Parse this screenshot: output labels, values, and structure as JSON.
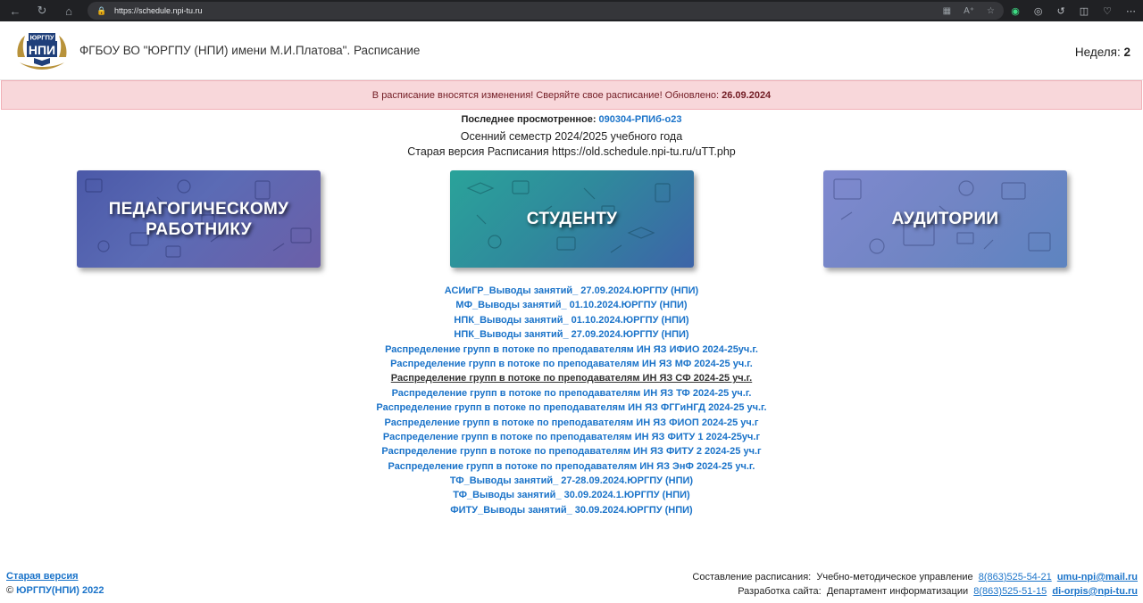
{
  "browser": {
    "url": "https://schedule.npi-tu.ru"
  },
  "header": {
    "logo_text_top": "ЮРГПУ",
    "logo_text_mid": "НПИ",
    "title": "ФГБОУ ВО \"ЮРГПУ (НПИ) имени М.И.Платова\". Расписание",
    "week_label": "Неделя:",
    "week_value": "2"
  },
  "alert": {
    "text": "В расписание вносятся изменения! Сверяйте свое расписание! Обновлено:",
    "date": "26.09.2024"
  },
  "info": {
    "last_viewed_label": "Последнее просмотренное:",
    "last_viewed_link": "090304-РПИб-о23",
    "semester": "Осенний семестр 2024/2025 учебного года",
    "old_version": "Старая версия Расписания https://old.schedule.npi-tu.ru/uTT.php"
  },
  "tiles": {
    "teacher_line1": "ПЕДАГОГИЧЕСКОМУ",
    "teacher_line2": "РАБОТНИКУ",
    "student": "СТУДЕНТУ",
    "room": "АУДИТОРИИ"
  },
  "links": [
    "АСИиГР_Выводы занятий_ 27.09.2024.ЮРГПУ (НПИ)",
    "МФ_Выводы занятий_ 01.10.2024.ЮРГПУ (НПИ)",
    "НПК_Выводы занятий_ 01.10.2024.ЮРГПУ (НПИ)",
    "НПК_Выводы занятий_ 27.09.2024.ЮРГПУ (НПИ)",
    "Распределение групп в потоке по преподавателям ИН ЯЗ ИФИО 2024-25уч.г.",
    "Распределение групп в потоке по преподавателям ИН ЯЗ МФ 2024-25 уч.г.",
    "Распределение групп в потоке по преподавателям ИН ЯЗ СФ 2024-25 уч.г.",
    "Распределение групп в потоке по преподавателям ИН ЯЗ ТФ 2024-25 уч.г.",
    "Распределение групп в потоке по преподавателям ИН ЯЗ ФГГиНГД 2024-25 уч.г.",
    "Распределение групп в потоке по преподавателям ИН ЯЗ ФИОП 2024-25 уч.г",
    "Распределение групп в потоке по преподавателям ИН ЯЗ ФИТУ 1 2024-25уч.г",
    "Распределение групп в потоке по преподавателям ИН ЯЗ ФИТУ 2 2024-25 уч.г",
    "Распределение групп в потоке по преподавателям ИН ЯЗ ЭнФ 2024-25 уч.г.",
    "ТФ_Выводы занятий_ 27-28.09.2024.ЮРГПУ (НПИ)",
    "ТФ_Выводы занятий_ 30.09.2024.1.ЮРГПУ (НПИ)",
    "ФИТУ_Выводы занятий_ 30.09.2024.ЮРГПУ (НПИ)"
  ],
  "footer": {
    "old_version": "Старая версия",
    "copyright_symbol": "©",
    "copyright": "ЮРГПУ(НПИ) 2022",
    "schedule_label": "Составление расписания:",
    "schedule_dept": "Учебно-методическое управление",
    "schedule_phone": "8(863)525-54-21",
    "schedule_email": "umu-npi@mail.ru",
    "dev_label": "Разработка сайта:",
    "dev_dept": "Департамент информатизации",
    "dev_phone": "8(863)525-51-15",
    "dev_email": "di-orpis@npi-tu.ru"
  },
  "colors": {
    "link": "#1a73c9",
    "alert_bg": "#f8d7da",
    "alert_text": "#721c24"
  }
}
